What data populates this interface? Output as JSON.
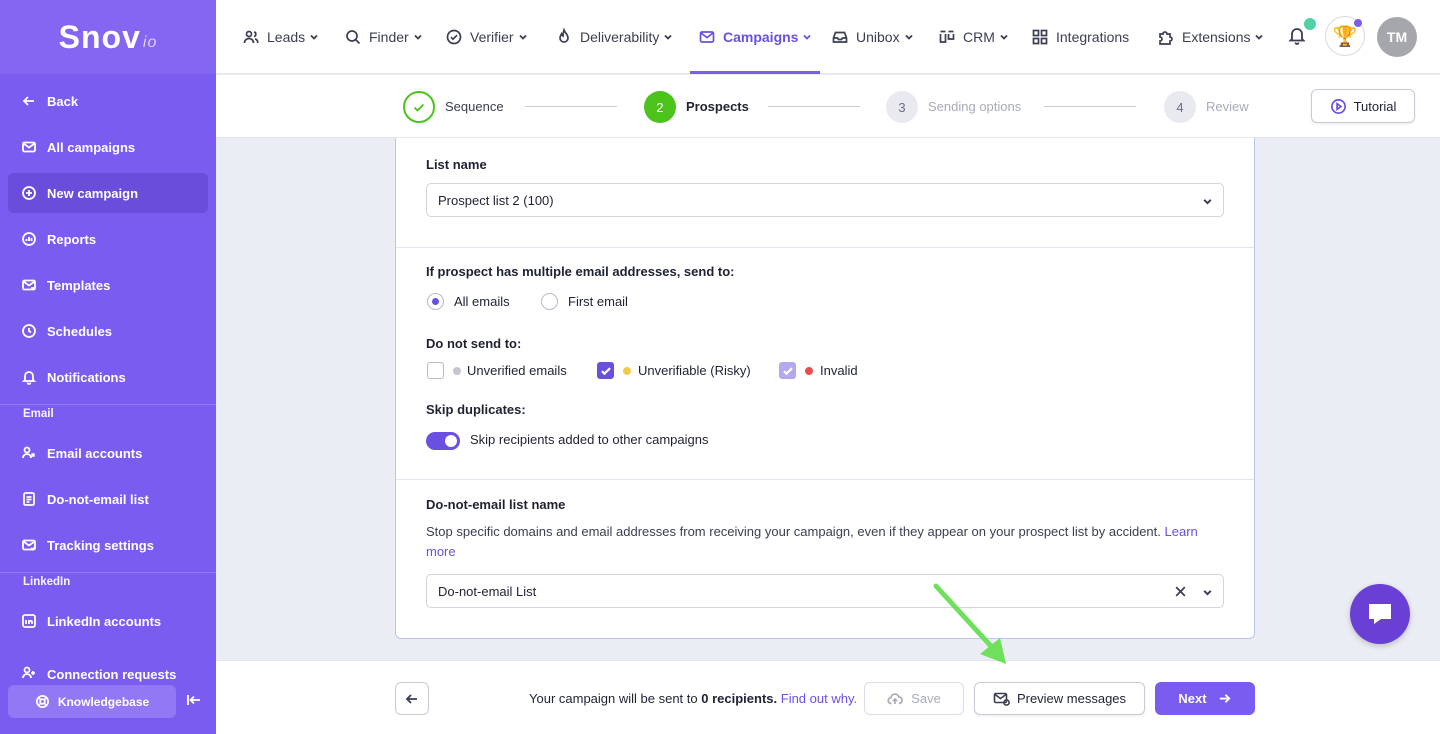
{
  "brand": {
    "name": "Snov",
    "suffix": "io"
  },
  "sidebar": {
    "items": [
      {
        "label": "Back",
        "icon": "arrow-left-icon"
      },
      {
        "label": "All campaigns",
        "icon": "mail-icon"
      },
      {
        "label": "New campaign",
        "icon": "plus-circle-icon",
        "active": true
      },
      {
        "label": "Reports",
        "icon": "chart-circle-icon"
      },
      {
        "label": "Templates",
        "icon": "template-icon"
      },
      {
        "label": "Schedules",
        "icon": "clock-icon"
      },
      {
        "label": "Notifications",
        "icon": "bell-icon"
      },
      {
        "label": "Email accounts",
        "icon": "users-icon"
      },
      {
        "label": "Do-not-email list",
        "icon": "list-icon"
      },
      {
        "label": "Tracking settings",
        "icon": "mail-check-icon"
      },
      {
        "label": "LinkedIn accounts",
        "icon": "linkedin-icon"
      },
      {
        "label": "Connection requests",
        "icon": "user-add-icon"
      }
    ],
    "section_email": "Email",
    "section_linkedin": "LinkedIn",
    "knowledgebase": "Knowledgebase"
  },
  "topnav": {
    "items": [
      {
        "label": "Leads"
      },
      {
        "label": "Finder"
      },
      {
        "label": "Verifier"
      },
      {
        "label": "Deliverability"
      },
      {
        "label": "Campaigns",
        "active": true
      },
      {
        "label": "Unibox"
      },
      {
        "label": "CRM"
      },
      {
        "label": "Integrations"
      },
      {
        "label": "Extensions"
      }
    ],
    "avatar_initials": "TM"
  },
  "steps": {
    "items": [
      {
        "num": "",
        "label": "Sequence",
        "state": "done"
      },
      {
        "num": "2",
        "label": "Prospects",
        "state": "current"
      },
      {
        "num": "3",
        "label": "Sending options",
        "state": "todo"
      },
      {
        "num": "4",
        "label": "Review",
        "state": "todo"
      }
    ],
    "tutorial": "Tutorial"
  },
  "form": {
    "list_name_label": "List name",
    "list_name_value": "Prospect list 2 (100)",
    "multi_email_label": "If prospect has multiple email addresses, send to:",
    "radio_all": "All emails",
    "radio_first": "First email",
    "do_not_send_label": "Do not send to:",
    "cb_unverified": "Unverified emails",
    "cb_unverifiable": "Unverifiable (Risky)",
    "cb_invalid": "Invalid",
    "skip_label": "Skip duplicates:",
    "skip_toggle_text": "Skip recipients added to other campaigns",
    "dne_label": "Do-not-email list name",
    "dne_desc": "Stop specific domains and email addresses from receiving your campaign, even if they appear on your prospect list by accident.",
    "dne_learn": "Learn more",
    "dne_value": "Do-not-email List"
  },
  "footer": {
    "send_text": "Your campaign will be sent to",
    "recipients": "0 recipients.",
    "find_out": "Find out why.",
    "save": "Save",
    "preview": "Preview messages",
    "next": "Next"
  },
  "colors": {
    "accent": "#7a5cf0",
    "success": "#4cc31a",
    "arrow": "#6ee05c"
  }
}
